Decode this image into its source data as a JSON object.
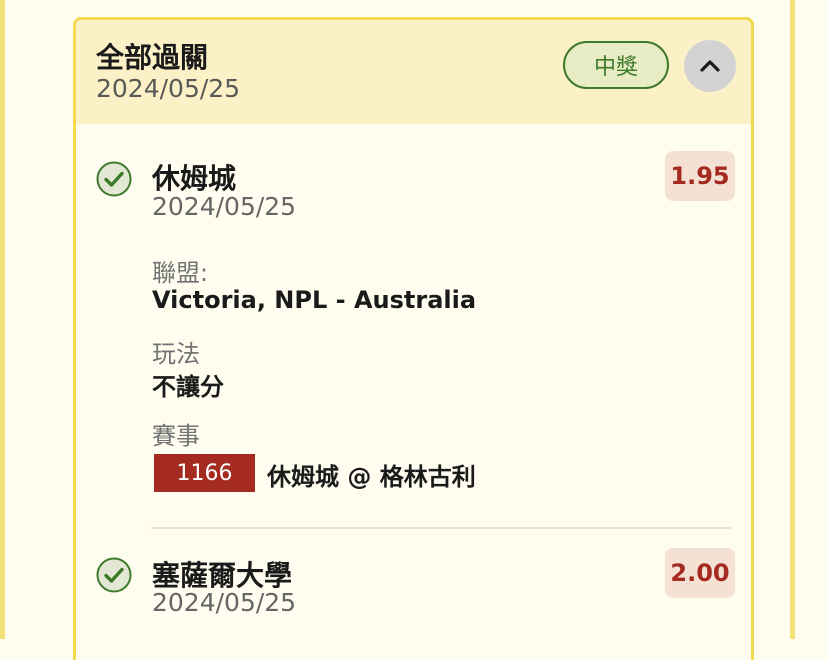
{
  "bet": {
    "title": "全部過關",
    "date": "2024/05/25",
    "status": "中獎"
  },
  "legs": [
    {
      "team": "休姆城",
      "date": "2024/05/25",
      "odds": "1.95",
      "league_label": "聯盟:",
      "league": "Victoria, NPL - Australia",
      "play_label": "玩法",
      "play": "不讓分",
      "match_label": "賽事",
      "match_id": "1166",
      "match_name": "休姆城 @ 格林古利"
    },
    {
      "team": "塞薩爾大學",
      "date": "2024/05/25",
      "odds": "2.00"
    }
  ],
  "colors": {
    "accent_border": "#f2d94e",
    "header_bg": "#fcf1c6",
    "win_green": "#3d7a2a",
    "odds_red": "#a52a1f"
  },
  "icons": {
    "check": "check-circle-icon",
    "collapse": "chevron-up-icon"
  }
}
